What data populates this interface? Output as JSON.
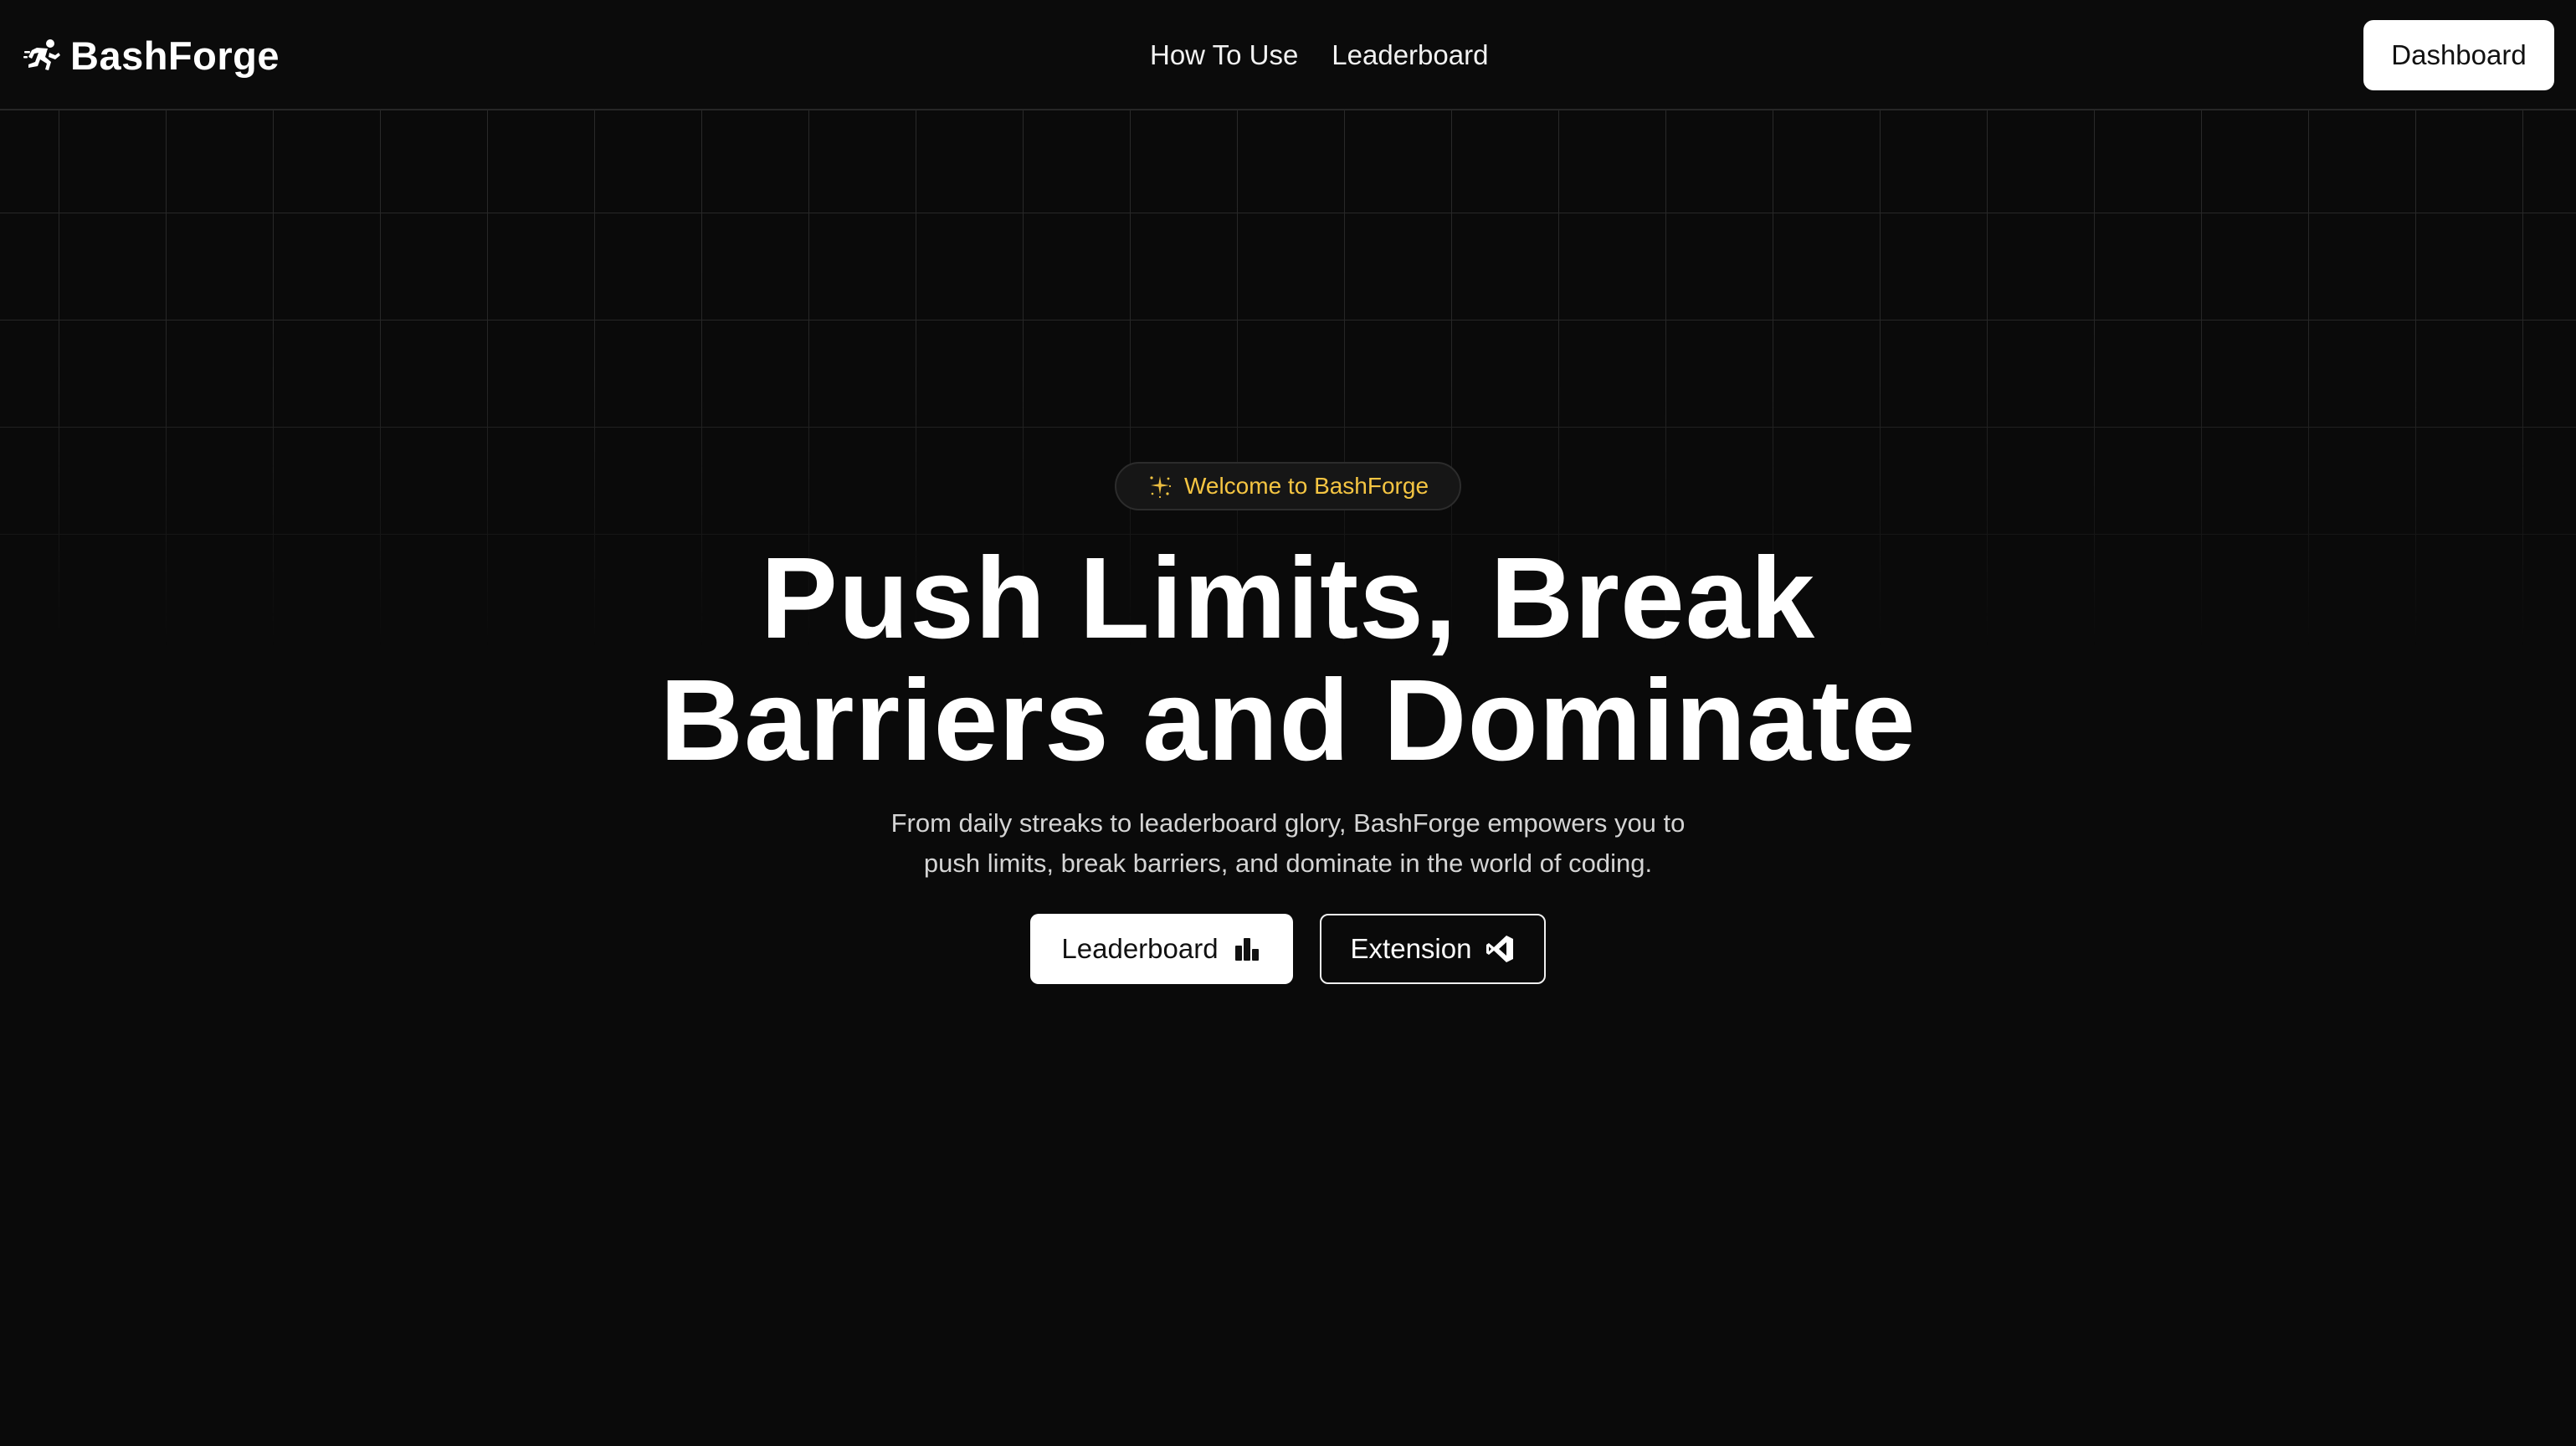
{
  "navbar": {
    "brand_name": "BashForge",
    "brand_icon": "runner-logo-icon",
    "links": [
      {
        "label": "How To Use"
      },
      {
        "label": "Leaderboard"
      }
    ],
    "dashboard_label": "Dashboard"
  },
  "hero": {
    "badge_icon": "sparkles-icon",
    "badge_text": "Welcome to BashForge",
    "headline_line1": "Push Limits, Break",
    "headline_line2": "Barriers and Dominate",
    "subtitle_line1": "From daily streaks to leaderboard glory, BashForge empowers you to",
    "subtitle_line2": "push limits, break barriers, and dominate in the world of coding.",
    "primary_cta": {
      "label": "Leaderboard",
      "icon": "bar-chart-icon"
    },
    "secondary_cta": {
      "label": "Extension",
      "icon": "vscode-icon"
    }
  },
  "colors": {
    "background": "#0a0a0a",
    "badge_text": "#f5c542",
    "button_primary_bg": "#ffffff",
    "text_primary": "#ffffff",
    "text_muted": "#d4d4d4"
  }
}
